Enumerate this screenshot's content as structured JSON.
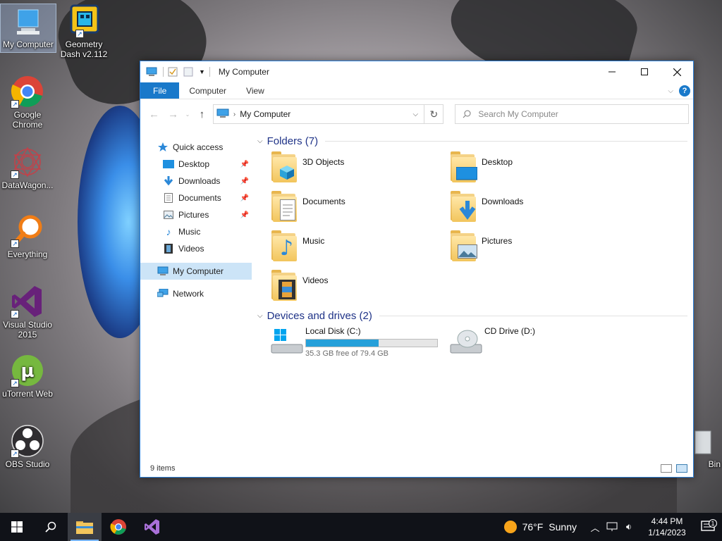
{
  "desktop": {
    "icons": [
      {
        "label": "My Computer"
      },
      {
        "label": "Geometry Dash v2.112"
      },
      {
        "label": "Google Chrome"
      },
      {
        "label": "DataWagon..."
      },
      {
        "label": "Everything"
      },
      {
        "label": "Visual Studio 2015"
      },
      {
        "label": "uTorrent Web"
      },
      {
        "label": "OBS Studio"
      },
      {
        "label": "Bin"
      }
    ]
  },
  "window": {
    "title": "My Computer",
    "ribbon_tabs": [
      "File",
      "Computer",
      "View"
    ],
    "address": {
      "location": "My Computer"
    },
    "search": {
      "placeholder": "Search My Computer"
    },
    "nav_pane": {
      "quick_access": "Quick access",
      "pinned": [
        "Desktop",
        "Downloads",
        "Documents",
        "Pictures"
      ],
      "unpinned": [
        "Music",
        "Videos"
      ],
      "this_pc": "My Computer",
      "network": "Network"
    },
    "folders_header": "Folders (7)",
    "folders": [
      "3D Objects",
      "Desktop",
      "Documents",
      "Downloads",
      "Music",
      "Pictures",
      "Videos"
    ],
    "devices_header": "Devices and drives (2)",
    "drives": [
      {
        "name": "Local Disk (C:)",
        "free_text": "35.3 GB free of 79.4 GB",
        "used_fraction": 0.555
      },
      {
        "name": "CD Drive (D:)"
      }
    ],
    "status": "9 items"
  },
  "taskbar": {
    "weather": {
      "temp": "76°F",
      "condition": "Sunny"
    },
    "time": "4:44 PM",
    "date": "1/14/2023",
    "notification_count": "1"
  },
  "colors": {
    "accent": "#1979ca",
    "drive_bar": "#26a0da",
    "folder": "#f2c55c"
  }
}
